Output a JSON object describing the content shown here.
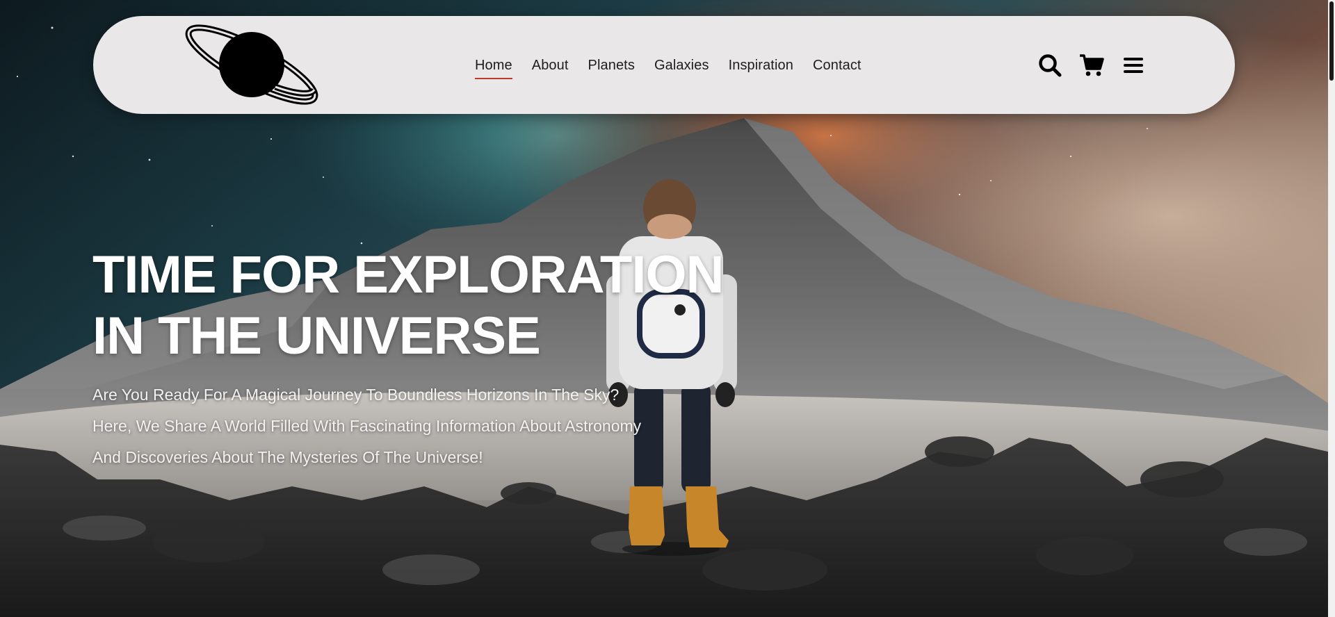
{
  "header": {
    "logo": "planet-with-ring-logo",
    "nav": [
      {
        "label": "Home",
        "active": true
      },
      {
        "label": "About",
        "active": false
      },
      {
        "label": "Planets",
        "active": false
      },
      {
        "label": "Galaxies",
        "active": false
      },
      {
        "label": "Inspiration",
        "active": false
      },
      {
        "label": "Contact",
        "active": false
      }
    ],
    "actions": [
      "search-icon",
      "cart-icon",
      "menu-icon"
    ]
  },
  "hero": {
    "title_line1": "TIME FOR EXPLORATION",
    "title_line2": "IN THE UNIVERSE",
    "subtitle_line1": "Are You Ready For A Magical Journey To Boundless Horizons In The Sky?",
    "subtitle_line2": "Here, We Share A World Filled With Fascinating Information About Astronomy",
    "subtitle_line3": "And Discoveries About The Mysteries Of The Universe!"
  },
  "colors": {
    "navbar_bg": "#e9e7e7",
    "nav_text": "#1d1d1d",
    "active_underline": "#c0392b",
    "hero_text": "#ffffff"
  }
}
